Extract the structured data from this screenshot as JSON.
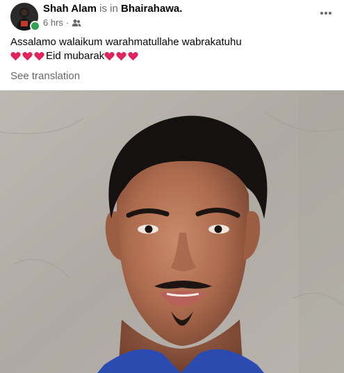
{
  "post": {
    "author": "Shah Alam",
    "is_in": "is in",
    "location": "Bhairahawa.",
    "time": "6 hrs",
    "separator": "·",
    "audience_icon": "friends-icon",
    "more_icon": "more-horizontal-icon",
    "text_line1": "Assalamo walaikum warahmatullahe wabrakatuhu",
    "text_greeting": "Eid mubarak",
    "hearts_before": 3,
    "hearts_after": 3,
    "heart_icon": "red-heart-emoji",
    "see_translation": "See translation"
  },
  "colors": {
    "primary_text": "#050505",
    "secondary_text": "#65676b",
    "heart": "#e0245e",
    "online": "#31a24c"
  }
}
